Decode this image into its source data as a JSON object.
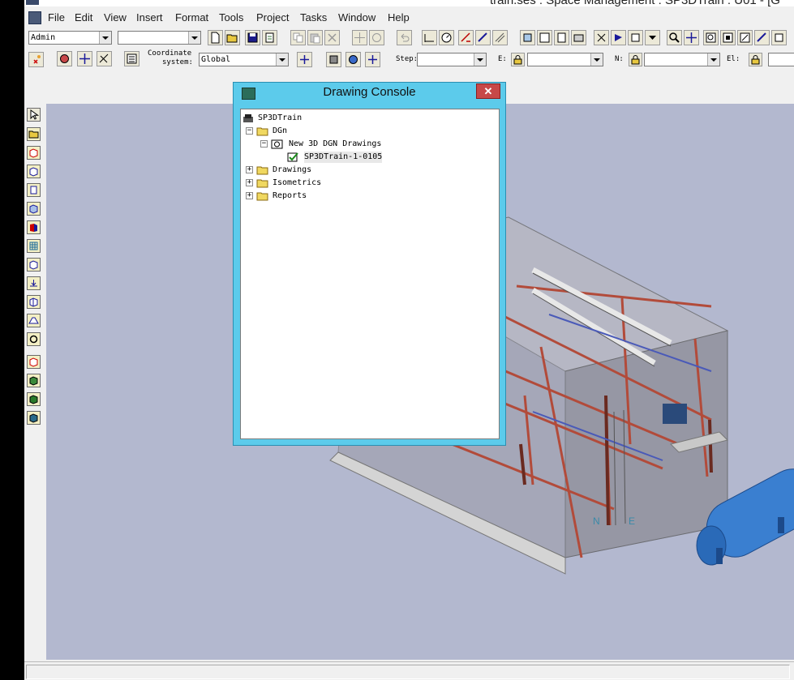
{
  "window": {
    "title": "train.ses : Space Management : SP3DTrain : U01 - [G"
  },
  "menu": [
    "File",
    "Edit",
    "View",
    "Insert",
    "Format",
    "Tools",
    "Project",
    "Tasks",
    "Window",
    "Help"
  ],
  "toolbar": {
    "permission_group": "Admin",
    "filter_value": "",
    "coordinate_label_line1": "Coordinate",
    "coordinate_label_line2": "system:",
    "coordinate_system": "Global",
    "step_label": "Step:",
    "step_value": "",
    "e_label": "E:",
    "e_value": "",
    "n_label": "N:",
    "n_value": "",
    "el_label": "El:",
    "el_value": ""
  },
  "drawing_console": {
    "title": "Drawing Console",
    "close_glyph": "✕",
    "tree": {
      "root": "SP3DTrain",
      "dgn": "DGn",
      "new_dgn": "New 3D DGN Drawings",
      "drawing_item": "SP3DTrain-1-0105",
      "drawings": "Drawings",
      "isometrics": "Isometrics",
      "reports": "Reports"
    }
  },
  "compass": {
    "n": "N",
    "e": "E"
  },
  "colors": {
    "console_frame": "#5ccbeb",
    "viewport_bg": "#b3b8cf",
    "close_button": "#c74848"
  },
  "icons": {
    "main_toolbar": [
      "new-icon",
      "open-icon",
      "save-icon",
      "properties-icon",
      "copy-icon",
      "paste-icon",
      "delete-icon",
      "move-icon",
      "rotate-icon",
      "undo-icon",
      "dimension-icon",
      "measure-icon",
      "check-icon",
      "select-icon",
      "fence-icon",
      "view-style-icon",
      "view-icon",
      "clip-icon",
      "camera-icon",
      "rotate-view-icon",
      "zoom-icon",
      "pan-icon",
      "zoom-area-icon",
      "fit-icon",
      "settings-icon"
    ],
    "second_toolbar": [
      "cancel-icon",
      "snap-icon",
      "tool-icon",
      "pin-icon",
      "layer-icon",
      "pinpoint-icon",
      "move-icon",
      "origin-icon",
      "lock-icon"
    ],
    "left_toolbar": [
      "select-arrow-icon",
      "space-folder-icon",
      "box-volume-icon",
      "volume-by-points-icon",
      "space-grid-icon",
      "space-path-icon",
      "reference-icon",
      "grid-icon",
      "drawing-volume-icon",
      "place-drawing-icon",
      "model-icon",
      "surface-icon",
      "link-icon",
      "volume-icon",
      "cube-green-icon",
      "cube-icon",
      "cube-layer-icon"
    ]
  }
}
